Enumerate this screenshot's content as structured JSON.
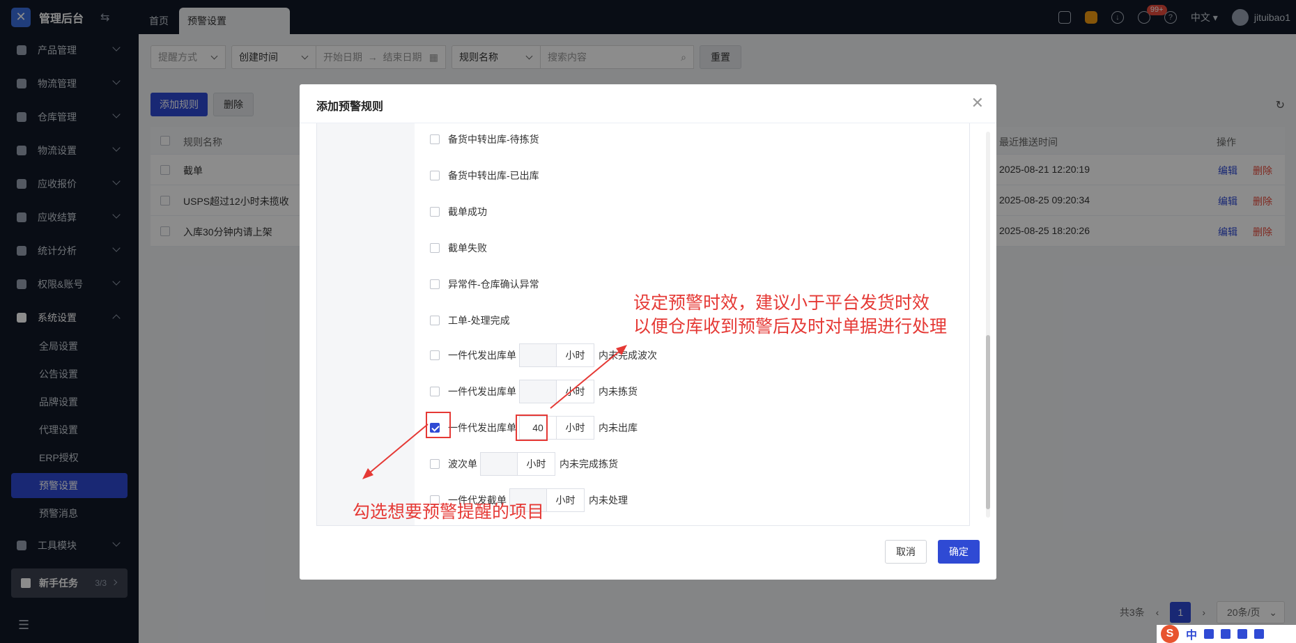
{
  "app": {
    "title": "管理后台"
  },
  "tabs": [
    {
      "label": "首页"
    },
    {
      "label": "预警设置"
    }
  ],
  "topbar": {
    "badge": "99+",
    "language": "中文",
    "username": "jituibao1"
  },
  "sidebar": {
    "items": [
      {
        "label": "产品管理",
        "icon": "box-icon"
      },
      {
        "label": "物流管理",
        "icon": "truck-icon"
      },
      {
        "label": "仓库管理",
        "icon": "warehouse-icon"
      },
      {
        "label": "物流设置",
        "icon": "package-icon"
      },
      {
        "label": "应收报价",
        "icon": "quote-icon"
      },
      {
        "label": "应收结算",
        "icon": "dollar-icon"
      },
      {
        "label": "统计分析",
        "icon": "chart-icon"
      },
      {
        "label": "权限&账号",
        "icon": "org-icon"
      },
      {
        "label": "系统设置",
        "icon": "settings-icon"
      }
    ],
    "sub_items": [
      {
        "label": "全局设置"
      },
      {
        "label": "公告设置"
      },
      {
        "label": "品牌设置"
      },
      {
        "label": "代理设置"
      },
      {
        "label": "ERP授权"
      },
      {
        "label": "预警设置"
      },
      {
        "label": "预警消息"
      }
    ],
    "tools": {
      "label": "工具模块"
    },
    "newbie": {
      "label": "新手任务",
      "progress": "3/3"
    }
  },
  "filters": {
    "remind_method": "提醒方式",
    "create_time": "创建时间",
    "start_date": "开始日期",
    "end_date": "结束日期",
    "rule_name": "规则名称",
    "search_placeholder": "搜索内容",
    "reset": "重置"
  },
  "actions": {
    "add_rule": "添加规则",
    "delete": "删除"
  },
  "table": {
    "headers": {
      "name": "规则名称",
      "last_push": "最近推送时间",
      "ops": "操作"
    },
    "rows": [
      {
        "name": "截单",
        "time": "2025-08-21 12:20:19",
        "edit": "编辑",
        "del": "删除"
      },
      {
        "name": "USPS超过12小时未揽收",
        "time": "2025-08-25 09:20:34",
        "edit": "编辑",
        "del": "删除"
      },
      {
        "name": "入库30分钟内请上架",
        "time": "2025-08-25 18:20:26",
        "edit": "编辑",
        "del": "删除"
      }
    ]
  },
  "pagination": {
    "total": "共3条",
    "page": "1",
    "page_size": "20条/页"
  },
  "modal": {
    "title": "添加预警规则",
    "options": [
      {
        "label": "备货中转出库-待拣货",
        "checked": false
      },
      {
        "label": "备货中转出库-已出库",
        "checked": false
      },
      {
        "label": "截单成功",
        "checked": false
      },
      {
        "label": "截单失败",
        "checked": false
      },
      {
        "label": "异常件-仓库确认异常",
        "checked": false
      },
      {
        "label": "工单-处理完成",
        "checked": false
      }
    ],
    "timed_options": [
      {
        "label": "一件代发出库单",
        "value": "",
        "unit": "小时",
        "suffix": "内未完成波次",
        "checked": false
      },
      {
        "label": "一件代发出库单",
        "value": "",
        "unit": "小时",
        "suffix": "内未拣货",
        "checked": false
      },
      {
        "label": "一件代发出库单",
        "value": "40",
        "unit": "小时",
        "suffix": "内未出库",
        "checked": true
      },
      {
        "label": "波次单",
        "value": "",
        "unit": "小时",
        "suffix": "内未完成拣货",
        "checked": false
      },
      {
        "label": "一件代发截单",
        "value": "",
        "unit": "小时",
        "suffix": "内未处理",
        "checked": false
      }
    ],
    "cancel": "取消",
    "confirm": "确定"
  },
  "annotations": {
    "top_line1": "设定预警时效，建议小于平台发货时效",
    "top_line2": "以便仓库收到预警后及时对单据进行处理",
    "bottom": "勾选想要预警提醒的项目",
    "color": "#e53935"
  },
  "ime": {
    "mode": "中"
  }
}
